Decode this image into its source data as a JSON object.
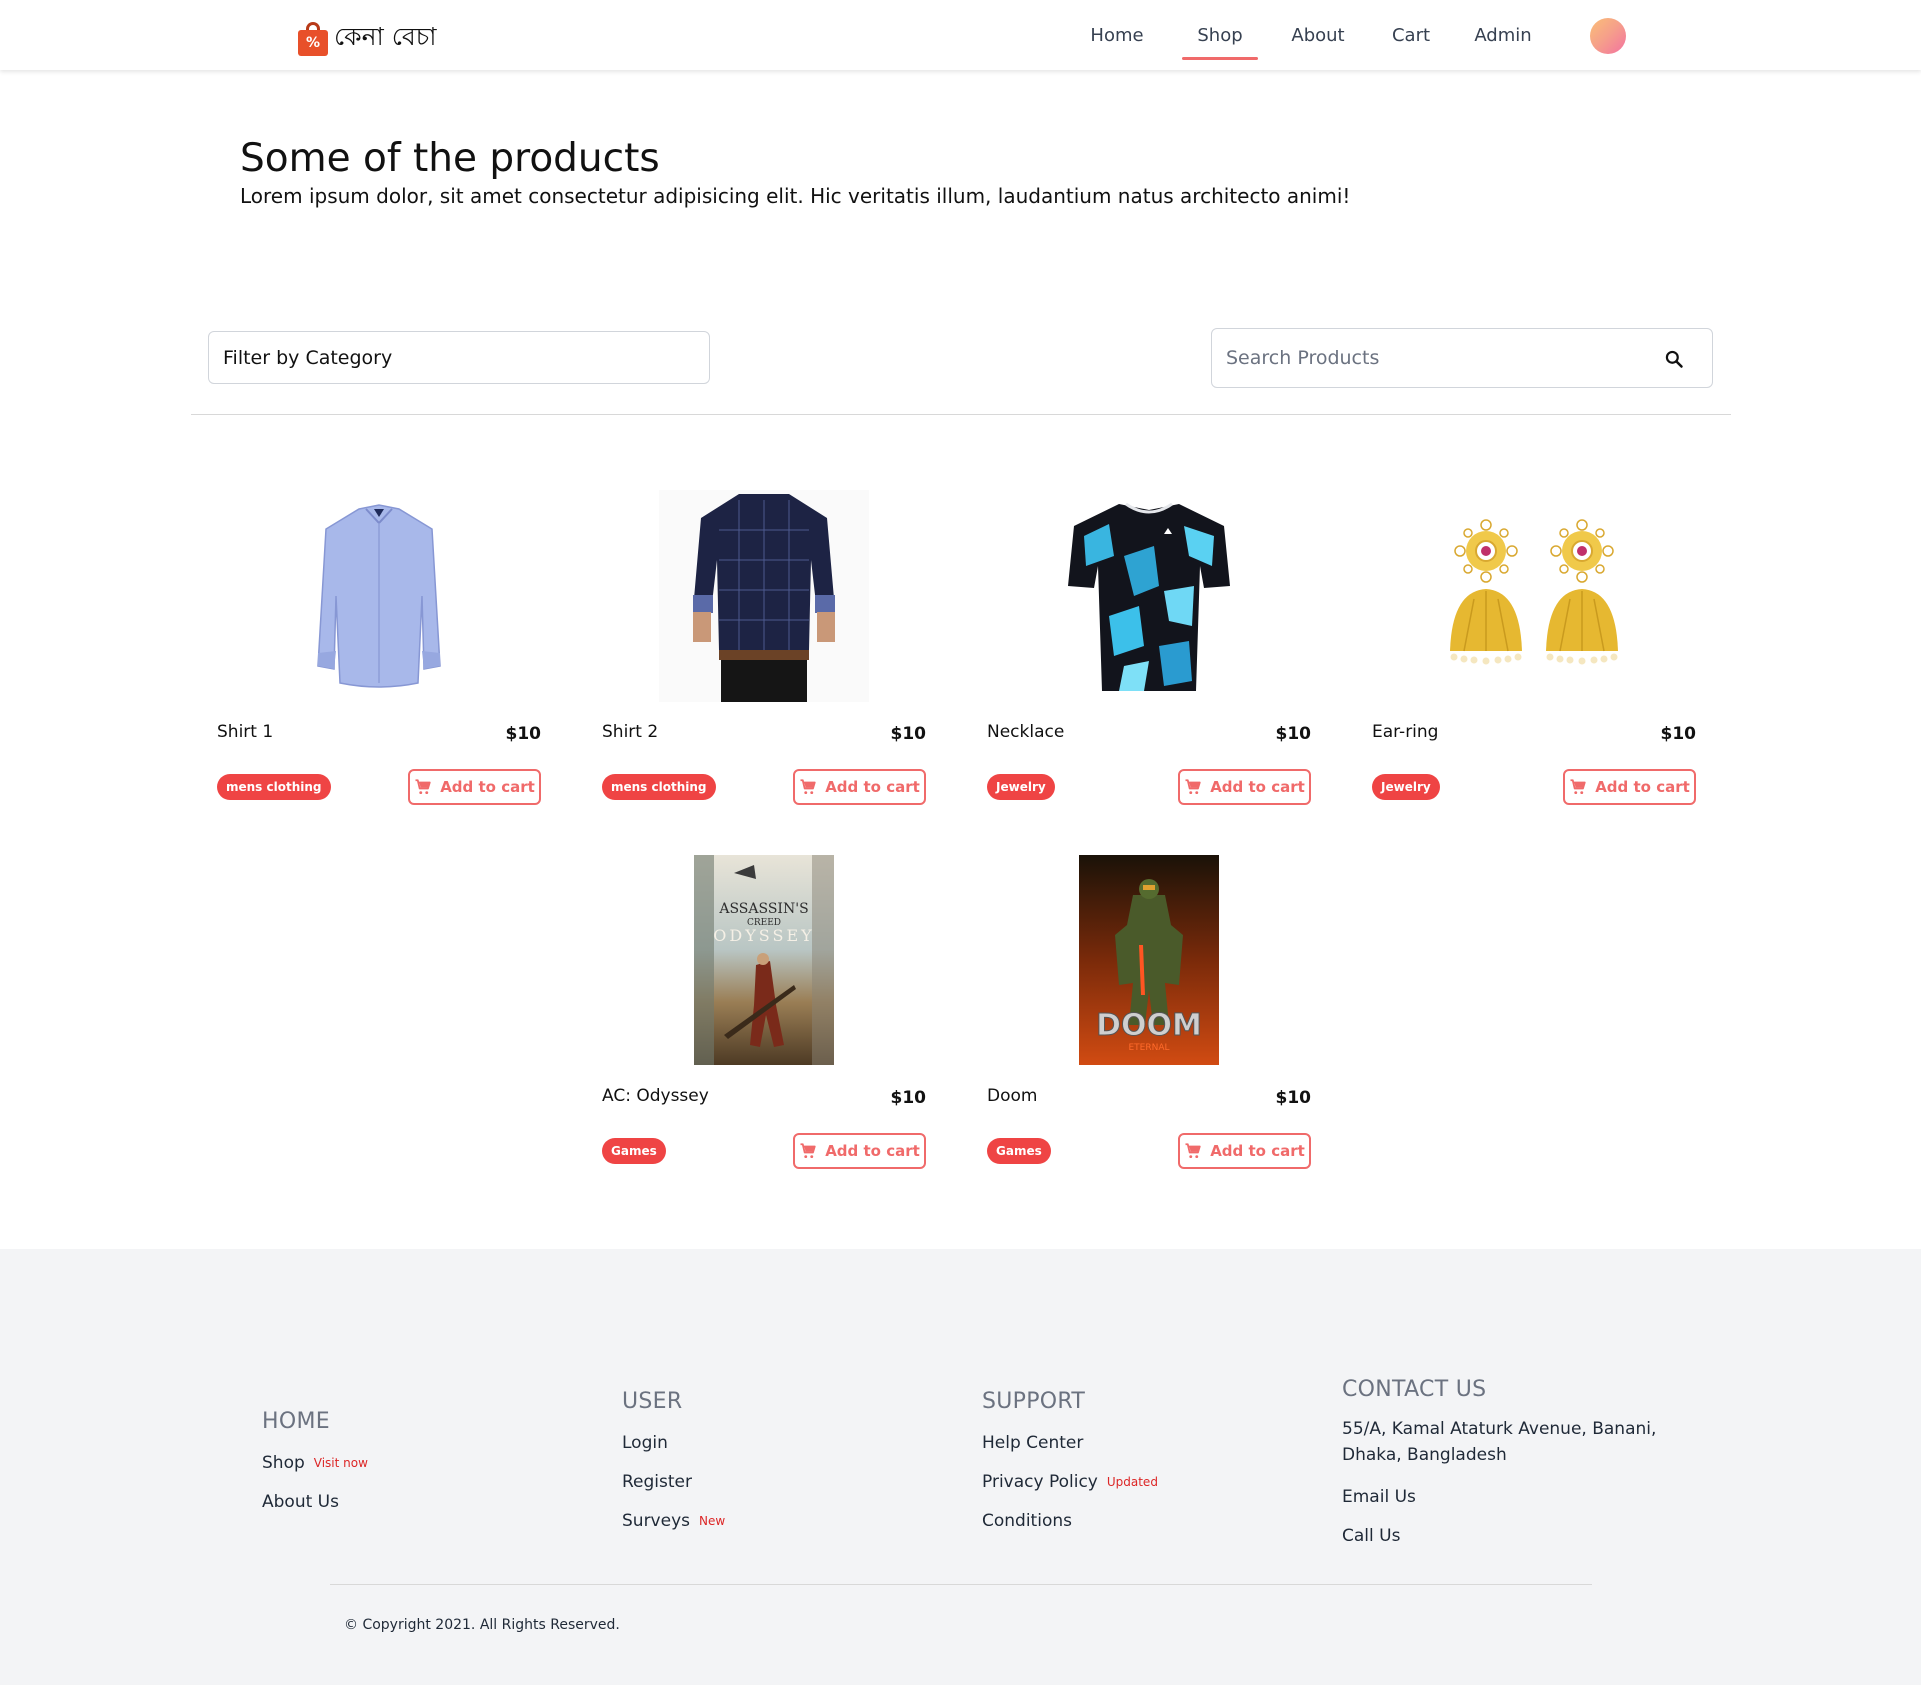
{
  "brand": {
    "name": "কেনা বেচা",
    "icon": "shopping-bag-percent-icon",
    "icon_color": "#e8502a"
  },
  "nav": {
    "items": [
      {
        "label": "Home",
        "active": false
      },
      {
        "label": "Shop",
        "active": true
      },
      {
        "label": "About",
        "active": false
      },
      {
        "label": "Cart",
        "active": false
      },
      {
        "label": "Admin",
        "active": false
      }
    ],
    "active_color": "#f06a6a"
  },
  "hero": {
    "title": "Some of the products",
    "subtitle": "Lorem ipsum dolor, sit amet consectetur adipisicing elit. Hic veritatis illum, laudantium natus architecto animi!"
  },
  "filter": {
    "label": "Filter by Category"
  },
  "search": {
    "placeholder": "Search Products",
    "icon": "search-icon"
  },
  "products": [
    {
      "name": "Shirt 1",
      "price": "$10",
      "category": "mens clothing",
      "button": "Add to cart",
      "image": "light blue dress shirt"
    },
    {
      "name": "Shirt 2",
      "price": "$10",
      "category": "mens clothing",
      "button": "Add to cart",
      "image": "navy checked shirt on model"
    },
    {
      "name": "Necklace",
      "price": "$10",
      "category": "Jewelry",
      "button": "Add to cart",
      "image": "blue black geometric jersey"
    },
    {
      "name": "Ear-ring",
      "price": "$10",
      "category": "Jewelry",
      "button": "Add to cart",
      "image": "gold jhumka earrings"
    },
    {
      "name": "AC: Odyssey",
      "price": "$10",
      "category": "Games",
      "button": "Add to cart",
      "image": "game cover"
    },
    {
      "name": "Doom",
      "price": "$10",
      "category": "Games",
      "button": "Add to cart",
      "image": "game cover"
    }
  ],
  "covers": {
    "odyssey": {
      "line1": "ASSASSIN'S",
      "line2": "CREED",
      "line3": "ODYSSEY"
    },
    "doom": {
      "line1": "DOOM",
      "line2": "ETERNAL"
    }
  },
  "colors": {
    "accent": "#f06a6a",
    "badge": "#ef4444",
    "footer_bg": "#f3f4f6"
  },
  "footer": {
    "home": {
      "heading": "HOME",
      "links": [
        {
          "label": "Shop",
          "tag": "Visit now"
        },
        {
          "label": "About Us",
          "tag": ""
        }
      ]
    },
    "user": {
      "heading": "USER",
      "links": [
        {
          "label": "Login",
          "tag": ""
        },
        {
          "label": "Register",
          "tag": ""
        },
        {
          "label": "Surveys",
          "tag": "New"
        }
      ]
    },
    "support": {
      "heading": "SUPPORT",
      "links": [
        {
          "label": "Help Center",
          "tag": ""
        },
        {
          "label": "Privacy Policy",
          "tag": "Updated"
        },
        {
          "label": "Conditions",
          "tag": ""
        }
      ]
    },
    "contact": {
      "heading": "CONTACT US",
      "address": "55/A, Kamal Ataturk Avenue, Banani, Dhaka, Bangladesh",
      "links": [
        {
          "label": "Email Us",
          "tag": ""
        },
        {
          "label": "Call Us",
          "tag": ""
        }
      ]
    },
    "copyright": "© Copyright 2021. All Rights Reserved."
  }
}
